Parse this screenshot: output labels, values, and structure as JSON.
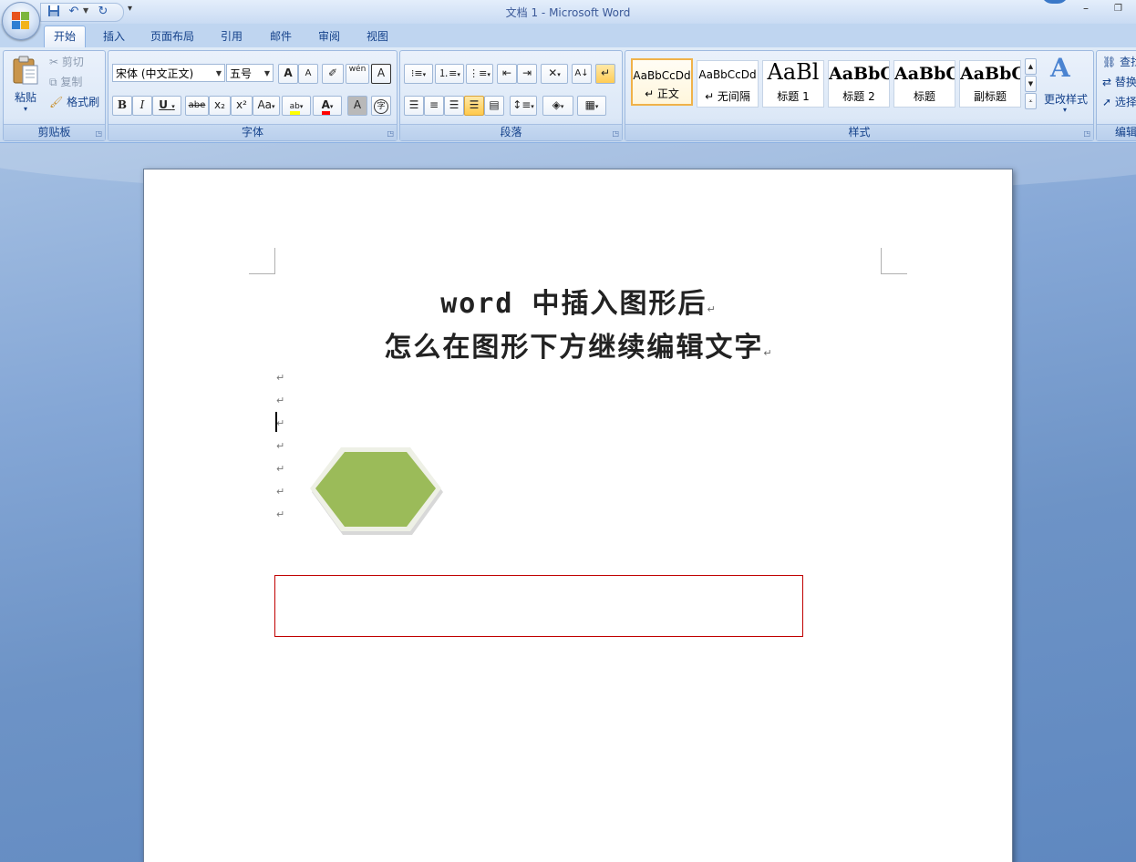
{
  "window": {
    "title": "文档 1 - Microsoft Word",
    "minimize": "–",
    "restore": "❐"
  },
  "tabs": [
    {
      "label": "开始",
      "active": true
    },
    {
      "label": "插入"
    },
    {
      "label": "页面布局"
    },
    {
      "label": "引用"
    },
    {
      "label": "邮件"
    },
    {
      "label": "审阅"
    },
    {
      "label": "视图"
    }
  ],
  "clipboard": {
    "paste": "粘贴",
    "cut": "剪切",
    "copy": "复制",
    "format_painter": "格式刷",
    "group_label": "剪贴板"
  },
  "font": {
    "font_name": "宋体 (中文正文)",
    "font_size": "五号",
    "grow": "A",
    "shrink": "A",
    "bold": "B",
    "italic": "I",
    "underline": "U",
    "strikethrough": "abe",
    "subscript": "x₂",
    "superscript": "x²",
    "change_case": "Aa",
    "highlight": "ab",
    "font_color": "A",
    "char_shade": "A",
    "enclose": "字",
    "phonetic": "wén",
    "border": "A",
    "group_label": "字体"
  },
  "paragraph": {
    "group_label": "段落"
  },
  "styles": {
    "items": [
      {
        "sample": "AaBbCcDd",
        "name": "↵ 正文"
      },
      {
        "sample": "AaBbCcDd",
        "name": "↵ 无间隔"
      },
      {
        "sample": "AaBl",
        "name": "标题 1"
      },
      {
        "sample": "AaBbC",
        "name": "标题 2"
      },
      {
        "sample": "AaBbC",
        "name": "标题"
      },
      {
        "sample": "AaBbC",
        "name": "副标题"
      }
    ],
    "change_styles": "更改样式",
    "group_label": "样式"
  },
  "editing": {
    "find": "查找",
    "replace": "替换",
    "select": "选择",
    "group_label": "编辑"
  },
  "document": {
    "title_line1": "word 中插入图形后",
    "title_line2": "怎么在图形下方继续编辑文字",
    "paragraph_mark": "↵"
  },
  "colors": {
    "hexagon_fill": "#9bbb59",
    "textbox_border": "#c00000",
    "highlight": "#ffff00",
    "font_color": "#ff0000"
  }
}
